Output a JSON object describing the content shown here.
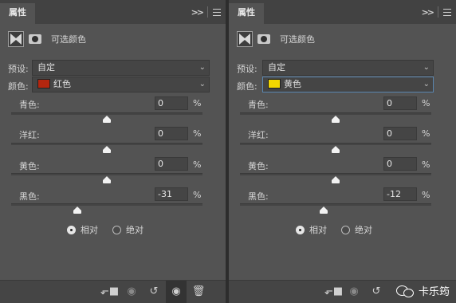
{
  "panels": [
    {
      "tab": "属性",
      "title": "可选颜色",
      "preset_label": "预设:",
      "preset_value": "自定",
      "color_label": "颜色:",
      "color_value": "红色",
      "color_swatch": "#b3260f",
      "sliders": [
        {
          "label": "青色:",
          "value": "0",
          "unit": "%",
          "level": 0
        },
        {
          "label": "洋红:",
          "value": "0",
          "unit": "%",
          "level": 0
        },
        {
          "label": "黄色:",
          "value": "0",
          "unit": "%",
          "level": 0
        },
        {
          "label": "黑色:",
          "value": "-31",
          "unit": "%",
          "level": -31
        }
      ],
      "mode_options": [
        "相对",
        "绝对"
      ],
      "mode_selected": "相对"
    },
    {
      "tab": "属性",
      "title": "可选颜色",
      "preset_label": "预设:",
      "preset_value": "自定",
      "color_label": "颜色:",
      "color_value": "黄色",
      "color_swatch": "#f2d600",
      "sliders": [
        {
          "label": "青色:",
          "value": "0",
          "unit": "%",
          "level": 0
        },
        {
          "label": "洋红:",
          "value": "0",
          "unit": "%",
          "level": 0
        },
        {
          "label": "黄色:",
          "value": "0",
          "unit": "%",
          "level": 0
        },
        {
          "label": "黑色:",
          "value": "-12",
          "unit": "%",
          "level": -12
        }
      ],
      "mode_options": [
        "相对",
        "绝对"
      ],
      "mode_selected": "相对"
    }
  ],
  "footer_icons": [
    "clip-to-layer-icon",
    "view-previous-state-icon",
    "reset-icon",
    "visibility-icon",
    "delete-icon"
  ],
  "watermark": "卡乐筠"
}
